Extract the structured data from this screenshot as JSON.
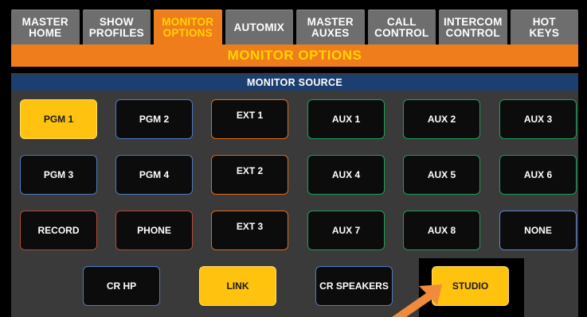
{
  "tabs": [
    {
      "label": "MASTER\nHOME",
      "active": false
    },
    {
      "label": "SHOW\nPROFILES",
      "active": false
    },
    {
      "label": "MONITOR\nOPTIONS",
      "active": true
    },
    {
      "label": "AUTOMIX",
      "active": false
    },
    {
      "label": "MASTER\nAUXES",
      "active": false
    },
    {
      "label": "CALL\nCONTROL",
      "active": false
    },
    {
      "label": "INTERCOM\nCONTROL",
      "active": false
    },
    {
      "label": "HOT\nKEYS",
      "active": false
    }
  ],
  "header": {
    "title": "MONITOR OPTIONS"
  },
  "monitor_source": {
    "title": "MONITOR SOURCE",
    "buttons": [
      {
        "label": "PGM 1",
        "selected": true
      },
      {
        "label": "PGM 2",
        "selected": false
      },
      {
        "label": "EXT 1",
        "selected": false
      },
      {
        "label": "AUX 1",
        "selected": false
      },
      {
        "label": "AUX 2",
        "selected": false
      },
      {
        "label": "AUX 3",
        "selected": false
      },
      {
        "label": "PGM 3",
        "selected": false
      },
      {
        "label": "PGM 4",
        "selected": false
      },
      {
        "label": "EXT 2",
        "selected": false
      },
      {
        "label": "AUX 4",
        "selected": false
      },
      {
        "label": "AUX 5",
        "selected": false
      },
      {
        "label": "AUX 6",
        "selected": false
      },
      {
        "label": "RECORD",
        "selected": false
      },
      {
        "label": "PHONE",
        "selected": false
      },
      {
        "label": "EXT 3",
        "selected": false
      },
      {
        "label": "AUX 7",
        "selected": false
      },
      {
        "label": "AUX 8",
        "selected": false
      },
      {
        "label": "NONE",
        "selected": false
      }
    ]
  },
  "output": {
    "buttons": [
      {
        "label": "CR HP",
        "selected": false
      },
      {
        "label": "LINK",
        "selected": true
      },
      {
        "label": "CR SPEAKERS",
        "selected": false
      },
      {
        "label": "STUDIO",
        "selected": true
      }
    ]
  },
  "colors": {
    "accent_orange": "#f07d1b",
    "title_yellow": "#ffd400",
    "selected_yellow": "#ffc20e",
    "section_blue": "#1d3f70",
    "pgm_border": "#4d7bbf",
    "ext_border": "#e06a1a",
    "aux_border": "#1f9e55",
    "record_border": "#b24a38"
  }
}
